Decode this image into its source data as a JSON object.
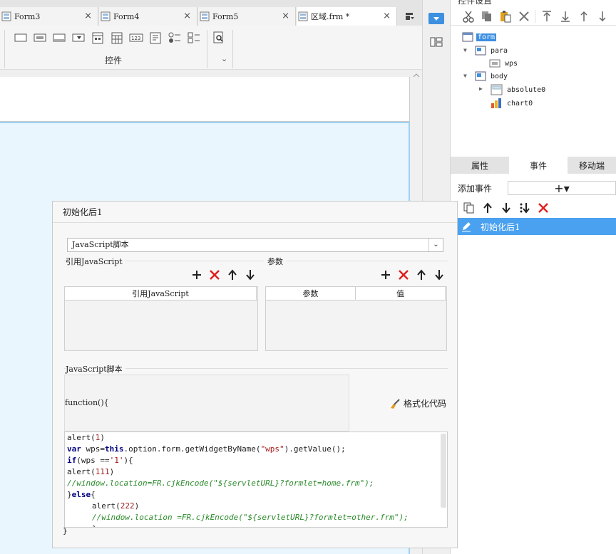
{
  "tabs": [
    {
      "label": "Form3",
      "close": "×"
    },
    {
      "label": "Form4",
      "close": "×"
    },
    {
      "label": "Form5",
      "close": "×"
    },
    {
      "label": "区域.frm *",
      "close": "×"
    }
  ],
  "widget_toolbar": {
    "group_label": "控件",
    "chevron": "⌄"
  },
  "tree_panel": {
    "title": "控件设置"
  },
  "widget_tree": [
    {
      "label": "form",
      "icon": "form-icon",
      "selected": true
    },
    {
      "label": "para",
      "icon": "panel-icon"
    },
    {
      "label": "wps",
      "icon": "label-widget-icon"
    },
    {
      "label": "body",
      "icon": "panel-icon"
    },
    {
      "label": "absolute0",
      "icon": "absolute-layout-icon"
    },
    {
      "label": "chart0",
      "icon": "chart-icon"
    }
  ],
  "property_tabs": [
    {
      "label": "属性"
    },
    {
      "label": "事件",
      "active": true
    },
    {
      "label": "移动端"
    }
  ],
  "events": {
    "add_label": "添加事件",
    "add_button": "+▾",
    "items": [
      {
        "label": "初始化后1"
      }
    ]
  },
  "dialog": {
    "title": "初始化后1",
    "script_type": "JavaScript脚本",
    "ref_js_label": "引用JavaScript",
    "params_label": "参数",
    "ref_js_column": "引用JavaScript",
    "params_columns": [
      "参数",
      "值"
    ],
    "script_label": "JavaScript脚本",
    "fn_header": "function(){",
    "format_button": "格式化代码",
    "fn_footer": "}"
  },
  "code_lines": [
    {
      "indent": false,
      "tokens": [
        {
          "t": "alert("
        },
        {
          "t": "1",
          "c": "num"
        },
        {
          "t": ")"
        }
      ]
    },
    {
      "indent": false,
      "tokens": [
        {
          "t": "var",
          "c": "kw"
        },
        {
          "t": " wps="
        },
        {
          "t": "this",
          "c": "kw"
        },
        {
          "t": ".option.form.getWidgetByName("
        },
        {
          "t": "\"wps\"",
          "c": "str"
        },
        {
          "t": ").getValue();"
        }
      ]
    },
    {
      "indent": false,
      "tokens": [
        {
          "t": "if",
          "c": "kw"
        },
        {
          "t": "(wps =="
        },
        {
          "t": "'1'",
          "c": "str"
        },
        {
          "t": "){"
        }
      ]
    },
    {
      "indent": false,
      "tokens": [
        {
          "t": "alert("
        },
        {
          "t": "111",
          "c": "num"
        },
        {
          "t": ")"
        }
      ]
    },
    {
      "indent": false,
      "tokens": [
        {
          "t": "//window.location=FR.cjkEncode(\"${servletURL}?formlet=home.frm\");",
          "c": "cmt"
        }
      ]
    },
    {
      "indent": false,
      "tokens": [
        {
          "t": "}"
        },
        {
          "t": "else",
          "c": "kw"
        },
        {
          "t": "{"
        }
      ]
    },
    {
      "indent": true,
      "tokens": [
        {
          "t": "alert("
        },
        {
          "t": "222",
          "c": "num"
        },
        {
          "t": ")"
        }
      ]
    },
    {
      "indent": true,
      "tokens": [
        {
          "t": "//window.location =FR.cjkEncode(\"${servletURL}?formlet=other.frm\");",
          "c": "cmt"
        }
      ]
    },
    {
      "indent": true,
      "tokens": [
        {
          "t": "}"
        }
      ]
    }
  ],
  "colors": {
    "accent": "#4aa1ef",
    "selection": "#3d8fe0",
    "body_region": "#eaf6fd",
    "delete_red": "#e02020"
  }
}
